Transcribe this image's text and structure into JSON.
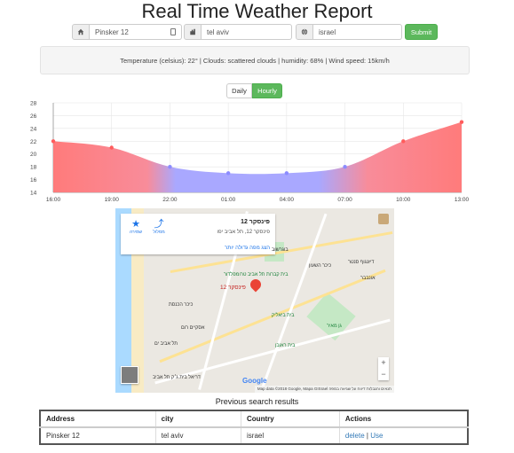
{
  "header": {
    "title": "Real Time Weather Report"
  },
  "search": {
    "address_value": "Pinsker 12",
    "city_value": "tel aviv",
    "country_value": "israel",
    "address_icon": "home-icon",
    "city_icon": "building-icon",
    "country_icon": "globe-icon",
    "submit_label": "Submit"
  },
  "summary": "Temperature (celsius): 22° | Clouds: scattered clouds | humidity: 68% | Wind speed: 15km/h",
  "view_toggle": {
    "daily_label": "Daily",
    "hourly_label": "Hourly",
    "active": "Hourly"
  },
  "chart_data": {
    "type": "area",
    "x": [
      "16:00",
      "19:00",
      "22:00",
      "01:00",
      "04:00",
      "07:00",
      "10:00",
      "13:00"
    ],
    "values": [
      22,
      21,
      18,
      17,
      17,
      18,
      22,
      25
    ],
    "ylim": [
      14,
      28
    ],
    "yticks": [
      14,
      16,
      18,
      20,
      22,
      24,
      26,
      28
    ],
    "grid": true,
    "colors": {
      "warm": "#ff6b6b",
      "cool": "#8c8cff"
    }
  },
  "map": {
    "place_title": "פינסקר 12",
    "place_address": "פינסקר 12, תל אביב יפו",
    "larger_map_link": "הצג מפה גדולה יותר",
    "directions_label": "מסלול",
    "save_label": "שמירה",
    "pin_label": "פינסקר 12",
    "places": [
      "בית קברות תל אביב טרומפלדור",
      "בית ביאליק",
      "בית ראובן",
      "גן מאיר",
      "כיכר הכנסת",
      "אסקיים רום",
      "תל אביב ים",
      "דיזנגוף סנטר",
      "אונבבר",
      "כיכר השעון",
      "בוגרשוב",
      "דריאל בית ג׳ק תל אביב"
    ],
    "google_logo": "Google",
    "attribution": "Map data ©2018 Google, Mapa GISrael   תנאים והגבלות   דיווח על שגיאה במפה",
    "zoom_in": "+",
    "zoom_out": "−"
  },
  "history": {
    "title": "Previous search results",
    "columns": [
      "Address",
      "city",
      "Country",
      "Actions"
    ],
    "rows": [
      {
        "address": "Pinsker 12",
        "city": "tel aviv",
        "country": "israel",
        "delete_label": "delete",
        "separator": "|",
        "use_label": "Use"
      }
    ]
  }
}
